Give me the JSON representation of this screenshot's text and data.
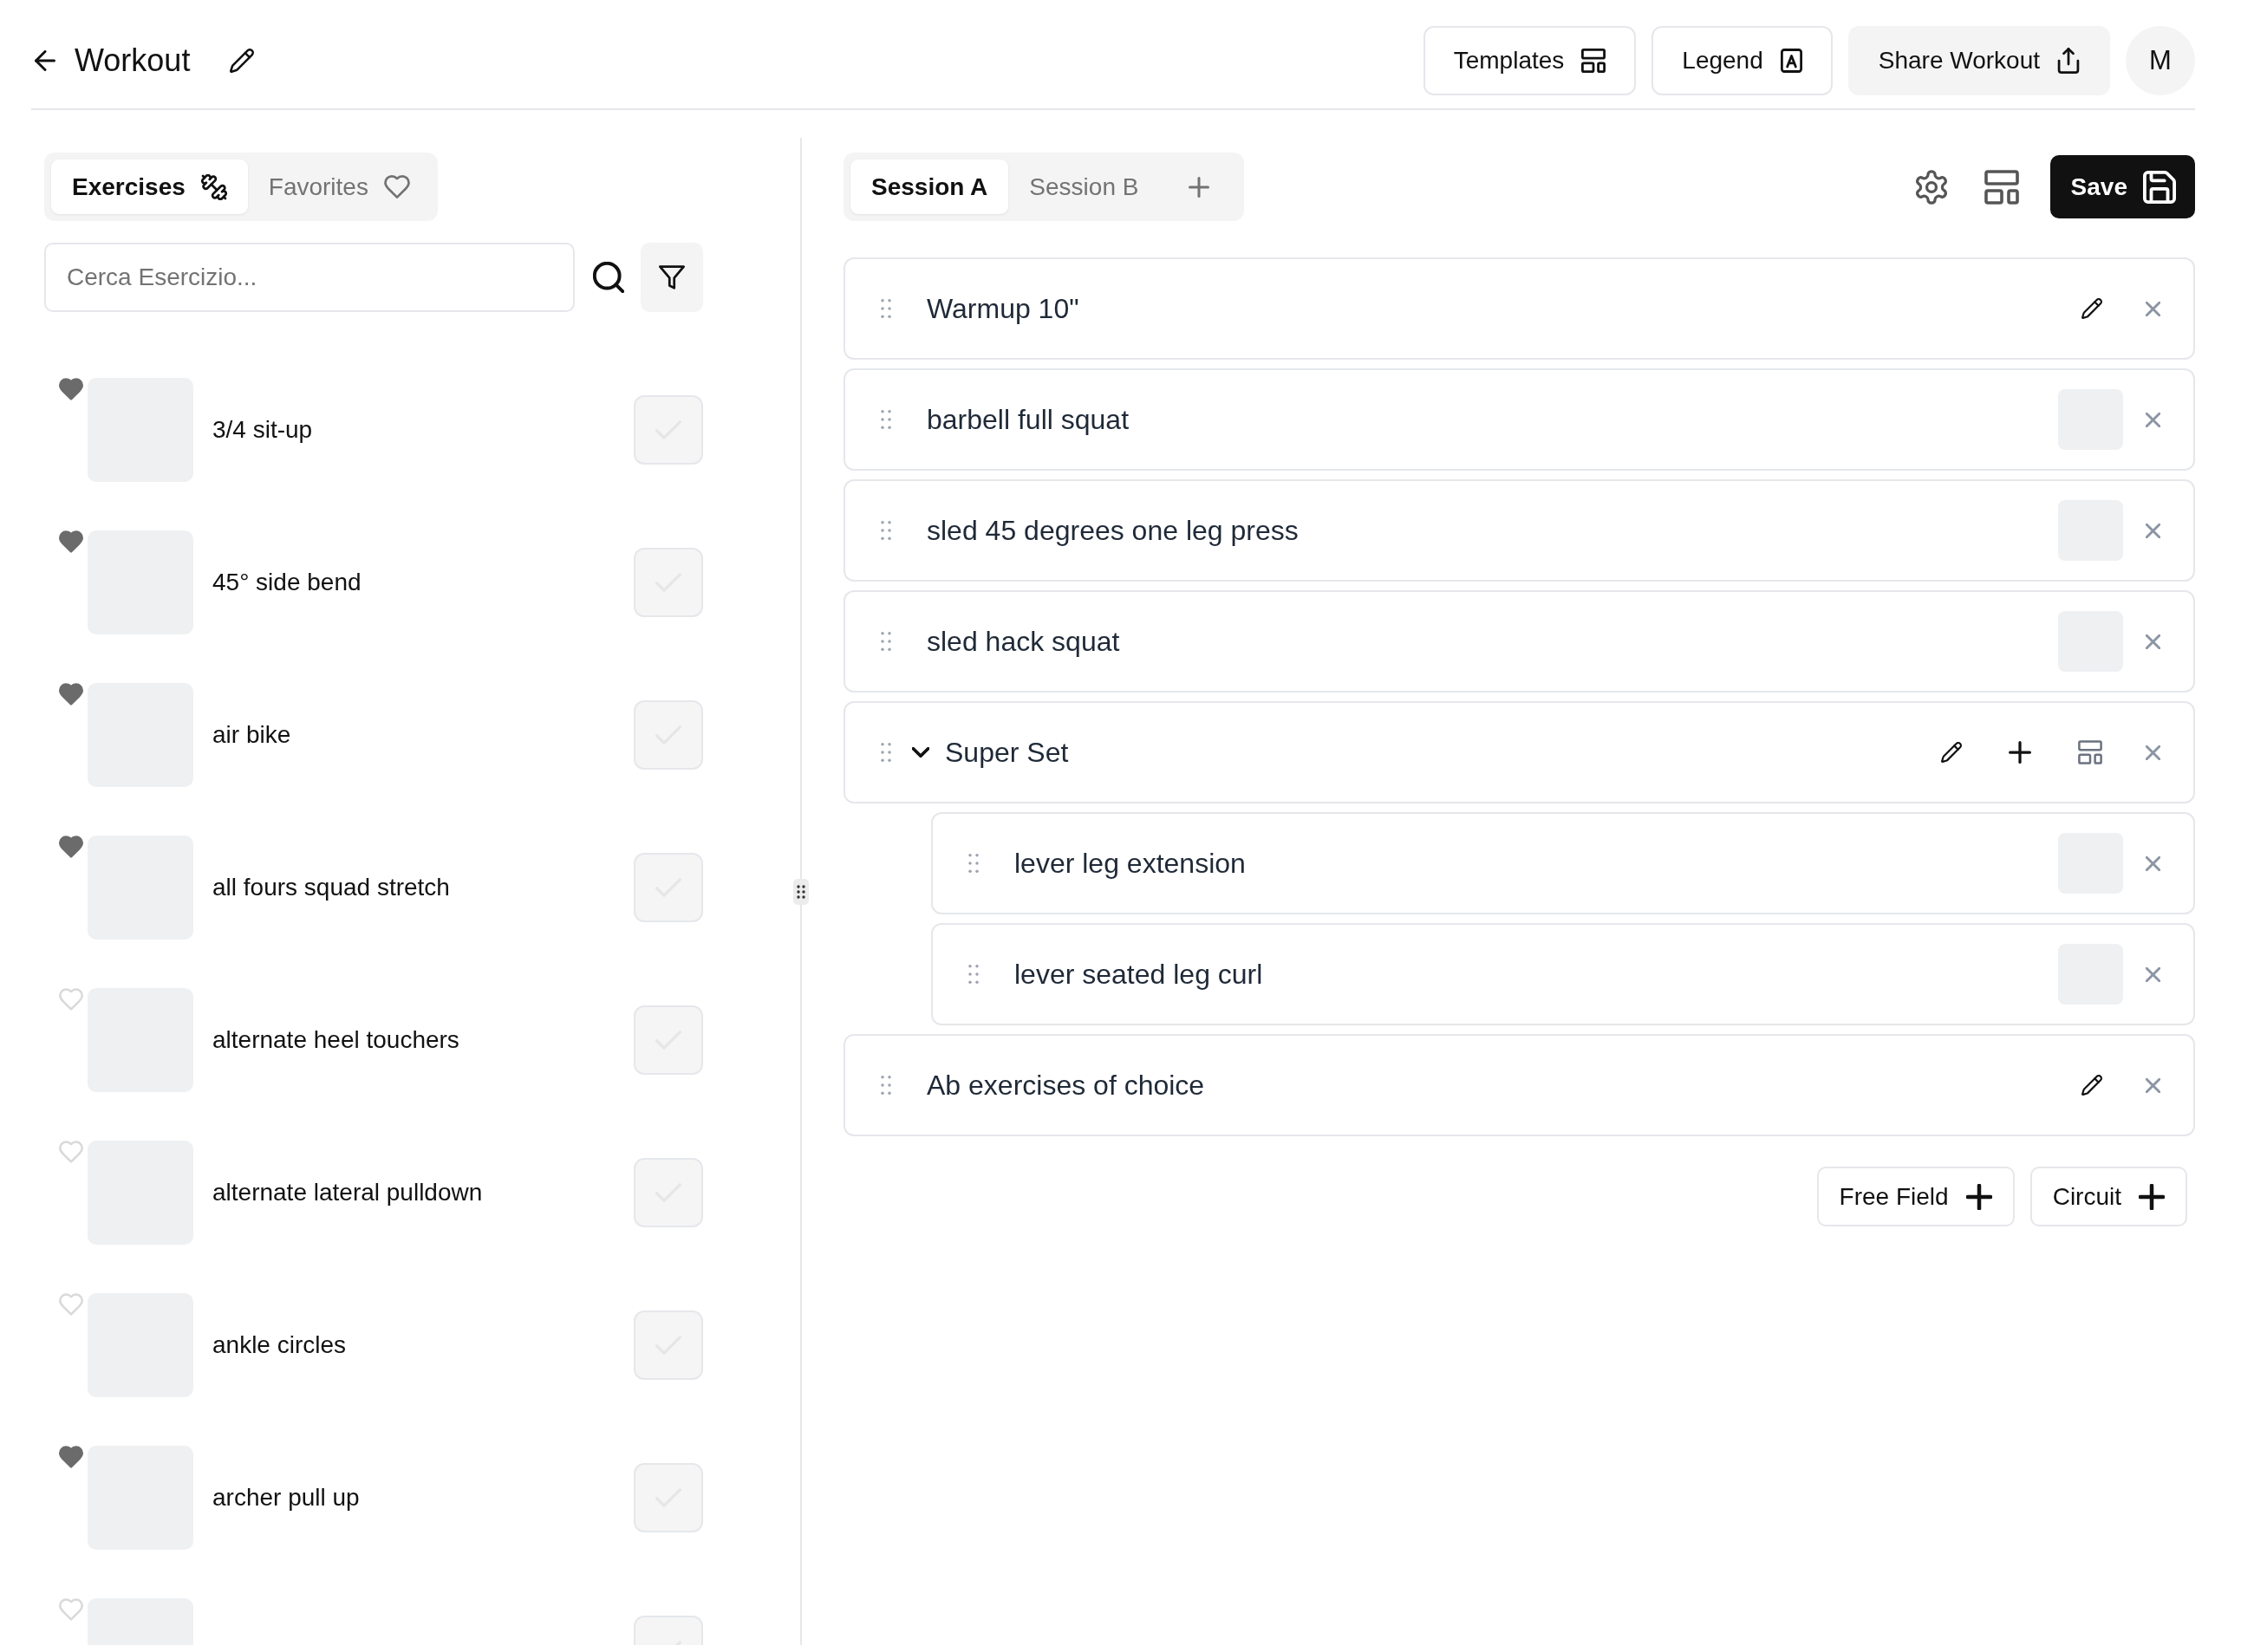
{
  "header": {
    "title": "Workout",
    "actions": [
      {
        "label": "Templates",
        "kind": "outlined"
      },
      {
        "label": "Legend",
        "kind": "outlined"
      },
      {
        "label": "Share Workout",
        "kind": "filled"
      }
    ],
    "avatar": "M"
  },
  "library": {
    "tabs": [
      {
        "label": "Exercises",
        "selected": true
      },
      {
        "label": "Favorites",
        "selected": false
      }
    ],
    "search": {
      "placeholder": "Cerca Esercizio..."
    },
    "exercises": [
      {
        "name": "3/4 sit-up",
        "favorite": true,
        "checked": false
      },
      {
        "name": "45° side bend",
        "favorite": true,
        "checked": false
      },
      {
        "name": "air bike",
        "favorite": true,
        "checked": false
      },
      {
        "name": "all fours squad stretch",
        "favorite": true,
        "checked": false
      },
      {
        "name": "alternate heel touchers",
        "favorite": false,
        "checked": false
      },
      {
        "name": "alternate lateral pulldown",
        "favorite": false,
        "checked": false
      },
      {
        "name": "ankle circles",
        "favorite": false,
        "checked": false
      },
      {
        "name": "archer pull up",
        "favorite": true,
        "checked": false
      },
      {
        "favorite": false,
        "checked": false
      }
    ]
  },
  "session": {
    "tabs": [
      {
        "label": "Session A",
        "selected": true
      },
      {
        "label": "Session B",
        "selected": false
      }
    ],
    "save": "Save",
    "items": [
      {
        "kind": "note",
        "title": "Warmup 10\""
      },
      {
        "kind": "exercise",
        "title": "barbell full squat"
      },
      {
        "kind": "exercise",
        "title": "sled 45 degrees one leg press"
      },
      {
        "kind": "exercise",
        "title": "sled hack squat"
      },
      {
        "kind": "superset",
        "title": "Super Set",
        "expanded": true,
        "children": [
          {
            "kind": "exercise",
            "title": "lever leg extension"
          },
          {
            "kind": "exercise",
            "title": "lever seated leg curl"
          }
        ]
      },
      {
        "kind": "note",
        "title": "Ab exercises of choice"
      }
    ],
    "add_buttons": [
      "Free Field",
      "Circuit"
    ]
  }
}
